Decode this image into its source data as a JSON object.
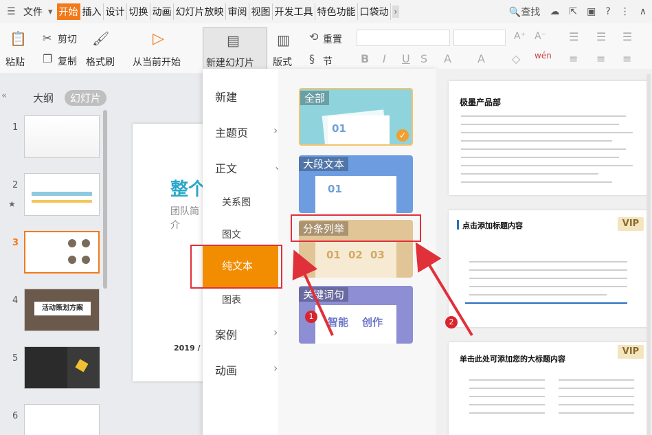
{
  "menubar": {
    "file_label": "文件",
    "tabs": [
      "开始",
      "插入",
      "设计",
      "切换",
      "动画",
      "幻灯片放映",
      "审阅",
      "视图",
      "开发工具",
      "特色功能",
      "口袋动"
    ],
    "active_tab": "开始",
    "search_label": "查找"
  },
  "ribbon": {
    "paste": "粘贴",
    "cut": "剪切",
    "copy": "复制",
    "format_painter": "格式刷",
    "from_current": "从当前开始",
    "new_slide": "新建幻灯片",
    "layout": "版式",
    "section": "节",
    "reset": "重置",
    "font_size_up": "A⁺",
    "font_size_down": "A⁻"
  },
  "leftpanel": {
    "tab_outline": "大纲",
    "tab_slides": "幻灯片",
    "slides": [
      {
        "num": "1"
      },
      {
        "num": "2"
      },
      {
        "num": "3"
      },
      {
        "num": "4",
        "caption": "活动策划方案"
      },
      {
        "num": "5"
      },
      {
        "num": "6"
      }
    ]
  },
  "canvas": {
    "title_partial": "整个",
    "subtitle_partial": "团队简介",
    "year": "2019 /"
  },
  "dropdown": {
    "categories": [
      "新建",
      "主题页",
      "正文",
      "案例",
      "动画"
    ],
    "subcategories": [
      "关系图",
      "图文",
      "纯文本",
      "图表"
    ],
    "active_sub": "纯文本",
    "cards": [
      {
        "label": "全部",
        "numbers": [
          "01"
        ]
      },
      {
        "label": "大段文本",
        "numbers": [
          "01"
        ]
      },
      {
        "label": "分条列举",
        "numbers": [
          "01",
          "02",
          "03"
        ]
      },
      {
        "label": "关键词句",
        "numbers": [
          "智能",
          "创作"
        ]
      }
    ]
  },
  "preview": {
    "p1_title": "极墨产品部",
    "p2_title": "点击添加标题内容",
    "p3_title": "单击此处可添加您的大标题内容",
    "vip": "VIP"
  },
  "annotations": {
    "badge1": "1",
    "badge2": "2"
  },
  "colors": {
    "accent": "#f27a1a",
    "active_sub_bg": "#f28c00",
    "annotation_red": "#e0303a"
  }
}
